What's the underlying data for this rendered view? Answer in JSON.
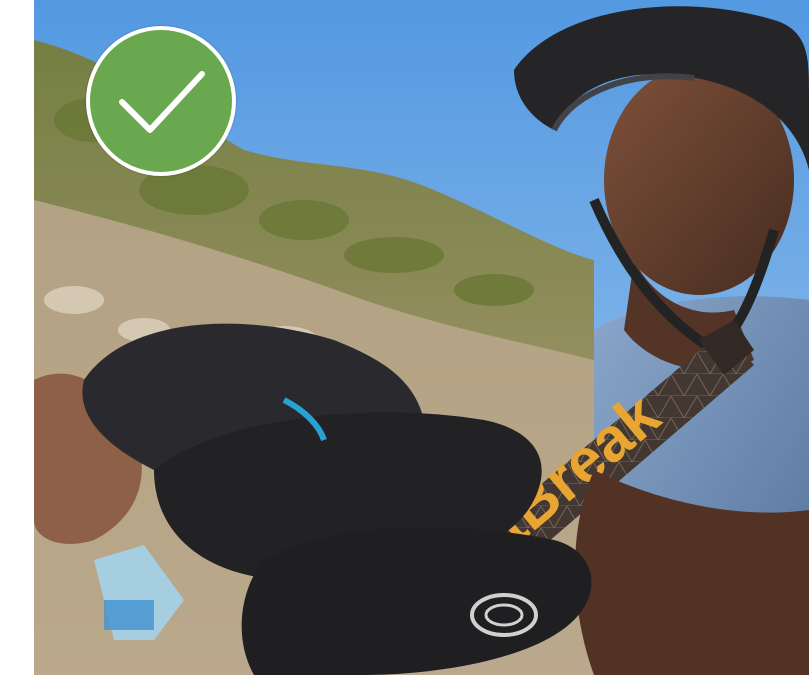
{
  "photo": {
    "description_free": true,
    "brand_text": "FastBreak"
  },
  "badge": {
    "icon": "checkmark-icon",
    "color": "#6aa84f"
  },
  "colors": {
    "sky": "#5aa0e6",
    "hill_green": "#7a8c46",
    "bar_wrapper": "#3a2e28",
    "bar_text": "#e8a22a",
    "shirt": "#6f8fb8"
  }
}
